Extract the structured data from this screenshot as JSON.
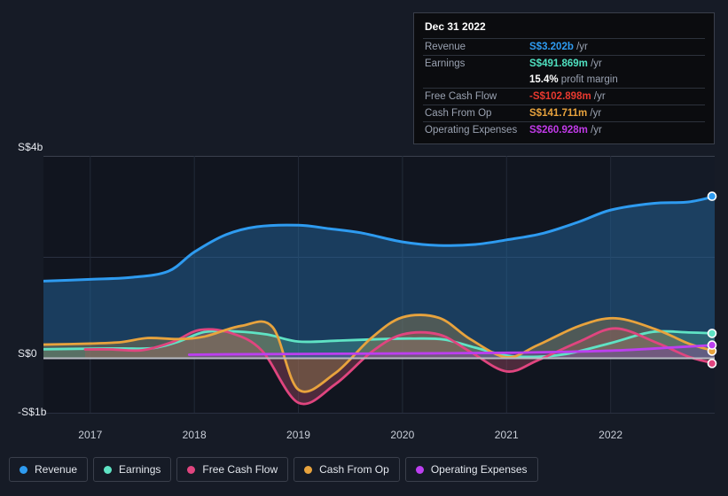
{
  "tooltip": {
    "date": "Dec 31 2022",
    "rows": [
      {
        "key": "Revenue",
        "value": "S$3.202b",
        "unit": "/yr",
        "color": "#2e9bf0",
        "bold": true
      },
      {
        "key": "Earnings",
        "value": "S$491.869m",
        "unit": "/yr",
        "color": "#4fe0c0",
        "bold": true
      },
      {
        "key": "",
        "value": "15.4%",
        "unit": "profit margin",
        "color": "#ffffff",
        "bold": true
      },
      {
        "key": "Free Cash Flow",
        "value": "-S$102.898m",
        "unit": "/yr",
        "color": "#e8392f",
        "bold": true
      },
      {
        "key": "Cash From Op",
        "value": "S$141.711m",
        "unit": "/yr",
        "color": "#e8a33d",
        "bold": true
      },
      {
        "key": "Operating Expenses",
        "value": "S$260.928m",
        "unit": "/yr",
        "color": "#c13ae8",
        "bold": true
      }
    ]
  },
  "legend": {
    "items": [
      {
        "label": "Revenue",
        "color": "#2e9bf0"
      },
      {
        "label": "Earnings",
        "color": "#5fe3c4"
      },
      {
        "label": "Free Cash Flow",
        "color": "#e0457f"
      },
      {
        "label": "Cash From Op",
        "color": "#e8a33d"
      },
      {
        "label": "Operating Expenses",
        "color": "#bc3ff0"
      }
    ]
  },
  "chart_data": {
    "type": "area",
    "title": "",
    "xlabel": "",
    "ylabel": "",
    "currency": "S$",
    "ylim": [
      -1000000000,
      4000000000
    ],
    "y_ticks": [
      {
        "label": "S$4b",
        "value": 4000000000
      },
      {
        "label": "S$0",
        "value": 0
      },
      {
        "label": "-S$1b",
        "value": -1000000000
      }
    ],
    "x_ticks": [
      "2017",
      "2018",
      "2019",
      "2020",
      "2021",
      "2022"
    ],
    "grid": true,
    "legend_position": "bottom",
    "series": [
      {
        "name": "Revenue",
        "color": "#2e9bf0",
        "fill": "rgba(38,110,170,0.45)",
        "x": [
          2016.55,
          2017.0,
          2017.4,
          2017.75,
          2018.0,
          2018.3,
          2018.6,
          2019.0,
          2019.3,
          2019.6,
          2020.0,
          2020.35,
          2020.7,
          2021.0,
          2021.35,
          2021.7,
          2022.0,
          2022.4,
          2022.75,
          2023.0
        ],
        "y": [
          1525000000,
          1560000000,
          1600000000,
          1720000000,
          2100000000,
          2440000000,
          2600000000,
          2630000000,
          2560000000,
          2480000000,
          2300000000,
          2230000000,
          2250000000,
          2340000000,
          2470000000,
          2700000000,
          2930000000,
          3060000000,
          3090000000,
          3202000000
        ]
      },
      {
        "name": "Earnings",
        "color": "#5fe3c4",
        "fill": "rgba(72,160,150,0.40)",
        "x": [
          2016.55,
          2017.0,
          2017.3,
          2017.6,
          2017.85,
          2018.1,
          2018.4,
          2018.7,
          2019.0,
          2019.4,
          2019.8,
          2020.1,
          2020.4,
          2020.7,
          2021.0,
          2021.3,
          2021.6,
          2022.0,
          2022.4,
          2022.75,
          2023.0
        ],
        "y": [
          178000000,
          190000000,
          195000000,
          200000000,
          330000000,
          520000000,
          530000000,
          470000000,
          330000000,
          350000000,
          380000000,
          390000000,
          370000000,
          210000000,
          55000000,
          30000000,
          95000000,
          300000000,
          520000000,
          510000000,
          491869000
        ]
      },
      {
        "name": "Free Cash Flow",
        "color": "#e0457f",
        "fill": "rgba(150,72,96,0.45)",
        "x": [
          2016.95,
          2017.2,
          2017.5,
          2017.8,
          2018.05,
          2018.35,
          2018.65,
          2019.0,
          2019.35,
          2019.7,
          2020.0,
          2020.35,
          2020.65,
          2021.0,
          2021.3,
          2021.7,
          2022.05,
          2022.45,
          2022.75,
          2023.0
        ],
        "y": [
          175000000,
          175000000,
          160000000,
          330000000,
          560000000,
          500000000,
          150000000,
          -880000000,
          -520000000,
          120000000,
          470000000,
          470000000,
          130000000,
          -260000000,
          -40000000,
          330000000,
          590000000,
          300000000,
          30000000,
          -102898000
        ]
      },
      {
        "name": "Cash From Op",
        "color": "#e8a33d",
        "fill": "rgba(150,128,78,0.42)",
        "x": [
          2016.55,
          2017.0,
          2017.3,
          2017.55,
          2017.85,
          2018.1,
          2018.45,
          2018.75,
          2019.0,
          2019.35,
          2019.7,
          2020.0,
          2020.35,
          2020.65,
          2021.0,
          2021.3,
          2021.7,
          2022.05,
          2022.45,
          2022.75,
          2023.0
        ],
        "y": [
          270000000,
          290000000,
          320000000,
          400000000,
          380000000,
          430000000,
          640000000,
          620000000,
          -620000000,
          -300000000,
          400000000,
          810000000,
          800000000,
          380000000,
          20000000,
          260000000,
          640000000,
          790000000,
          560000000,
          290000000,
          141711000
        ]
      },
      {
        "name": "Operating Expenses",
        "color": "#bc3ff0",
        "fill": "rgba(110,66,170,0.42)",
        "x": [
          2017.95,
          2018.3,
          2019.0,
          2020.0,
          2021.0,
          2022.0,
          2022.6,
          2023.0
        ],
        "y": [
          70000000,
          78000000,
          86000000,
          95000000,
          108000000,
          150000000,
          215000000,
          260928000
        ]
      }
    ]
  }
}
